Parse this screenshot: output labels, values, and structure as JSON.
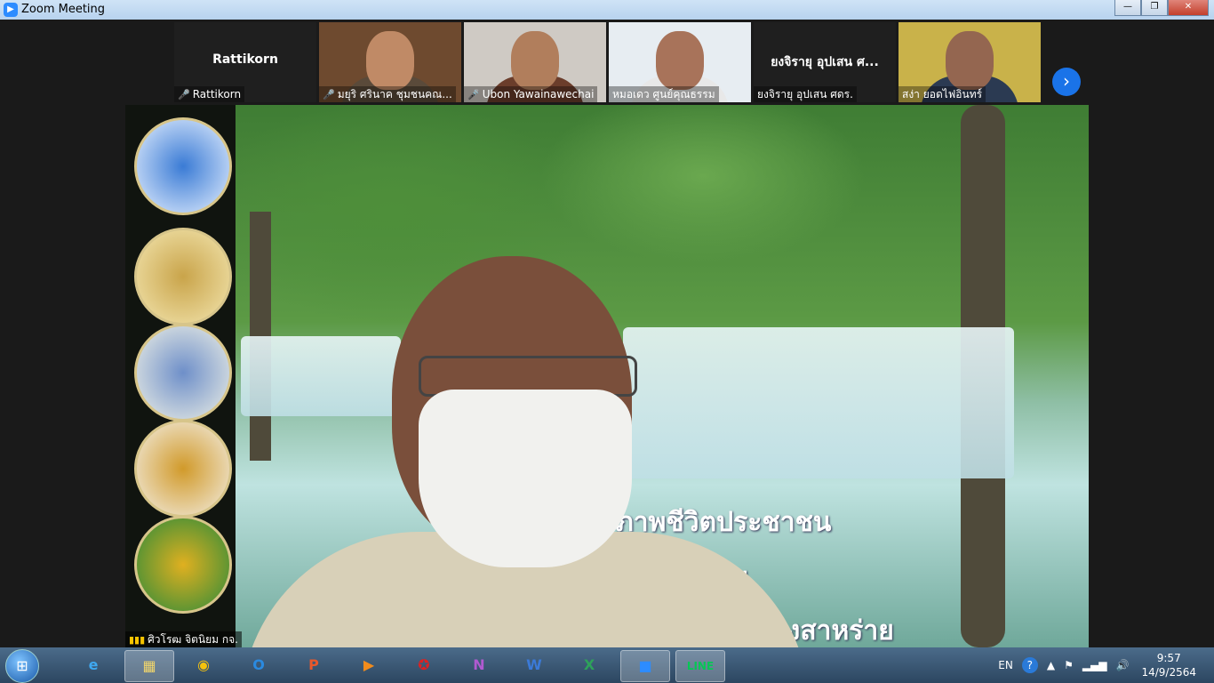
{
  "window": {
    "title": "Zoom Meeting",
    "minimize": "—",
    "restore": "❐",
    "close": "✕"
  },
  "participants": [
    {
      "name": "Rattikorn",
      "center_name": "Rattikorn",
      "muted": true
    },
    {
      "name": "มยุริ ศรินาค ชุมชนคณ...",
      "muted": true
    },
    {
      "name": "Ubon Yawainawechai",
      "muted": true
    },
    {
      "name": "หมอเดว ศูนย์คุณธรรม",
      "muted": false
    },
    {
      "name": "ยงจิรายุ อุปเสน ศดร.",
      "center_name": "ยงจิรายุ อุปเสน ศ...",
      "muted": false
    },
    {
      "name": "สง่า ยอดไฟอินทร์",
      "muted": false
    }
  ],
  "next_label": "›",
  "active_speaker": {
    "name": "ศิวโรฒ จิตนิยม กจ."
  },
  "slide_text": [
    "ภาพชีวิตประชาชน",
    "ยั่งยืน",
    "ลหนองสาหร่าย"
  ],
  "taskbar": {
    "start": "⊞",
    "apps": [
      {
        "name": "ie",
        "label": "e"
      },
      {
        "name": "explorer",
        "label": "▦"
      },
      {
        "name": "chrome",
        "label": "◉"
      },
      {
        "name": "outlook",
        "label": "O"
      },
      {
        "name": "powerpoint",
        "label": "P"
      },
      {
        "name": "media",
        "label": "▶"
      },
      {
        "name": "app-red",
        "label": "✪"
      },
      {
        "name": "onenote",
        "label": "N"
      },
      {
        "name": "word",
        "label": "W"
      },
      {
        "name": "excel",
        "label": "X"
      },
      {
        "name": "zoom",
        "label": "■"
      },
      {
        "name": "line",
        "label": "LINE"
      }
    ],
    "language": "EN",
    "help": "?",
    "time": "9:57",
    "date": "14/9/2564"
  }
}
